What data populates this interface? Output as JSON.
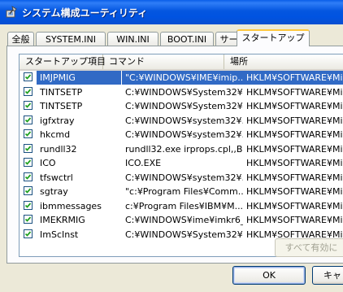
{
  "window": {
    "title": "システム構成ユーティリティ",
    "icon": "msconfig-icon"
  },
  "tabs": [
    {
      "label": "全般"
    },
    {
      "label": "SYSTEM.INI"
    },
    {
      "label": "WIN.INI"
    },
    {
      "label": "BOOT.INI"
    },
    {
      "label": "サービス"
    },
    {
      "label": "スタートアップ",
      "active": true
    }
  ],
  "list": {
    "columns": [
      "スタートアップ項目",
      "コマンド",
      "場所"
    ],
    "rows": [
      {
        "name": "IMJPMIG",
        "command": "\"C:¥WINDOWS¥IME¥imip...",
        "location": "HKLM¥SOFTWARE¥Micr...",
        "checked": true,
        "selected": true
      },
      {
        "name": "TINTSETP",
        "command": "C:¥WINDOWS¥System32¥...",
        "location": "HKLM¥SOFTWARE¥Micr...",
        "checked": true
      },
      {
        "name": "TINTSETP",
        "command": "C:¥WINDOWS¥System32¥...",
        "location": "HKLM¥SOFTWARE¥Micr...",
        "checked": true
      },
      {
        "name": "igfxtray",
        "command": "C:¥WINDOWS¥system32¥...",
        "location": "HKLM¥SOFTWARE¥Micr...",
        "checked": true
      },
      {
        "name": "hkcmd",
        "command": "C:¥WINDOWS¥system32¥...",
        "location": "HKLM¥SOFTWARE¥Micr...",
        "checked": true
      },
      {
        "name": "rundll32",
        "command": "rundll32.exe irprops.cpl,,B...",
        "location": "HKLM¥SOFTWARE¥Micr...",
        "checked": true
      },
      {
        "name": "ICO",
        "command": "ICO.EXE",
        "location": "HKLM¥SOFTWARE¥Micr...",
        "checked": true
      },
      {
        "name": "tfswctrl",
        "command": "C:¥WINDOWS¥system32¥...",
        "location": "HKLM¥SOFTWARE¥Micr...",
        "checked": true
      },
      {
        "name": "sgtray",
        "command": "\"c:¥Program Files¥Comm...",
        "location": "HKLM¥SOFTWARE¥Micr...",
        "checked": true
      },
      {
        "name": "ibmmessages",
        "command": "c:¥Program Files¥IBM¥M...",
        "location": "HKLM¥SOFTWARE¥Micr...",
        "checked": true
      },
      {
        "name": "IMEKRMIG",
        "command": "C:¥WINDOWS¥ime¥imkr6_...",
        "location": "HKLM¥SOFTWARE¥Micr...",
        "checked": true
      },
      {
        "name": "ImScInst",
        "command": "C:¥WINDOWS¥System32¥...",
        "location": "HKLM¥SOFTWARE¥Micr...",
        "checked": true
      }
    ]
  },
  "buttons": {
    "enable_all": "すべて有効に",
    "ok": "OK",
    "cancel": "キャ"
  },
  "colors": {
    "selection": "#316ac5",
    "titlebar": "#0053e1",
    "check": "#21a121"
  }
}
